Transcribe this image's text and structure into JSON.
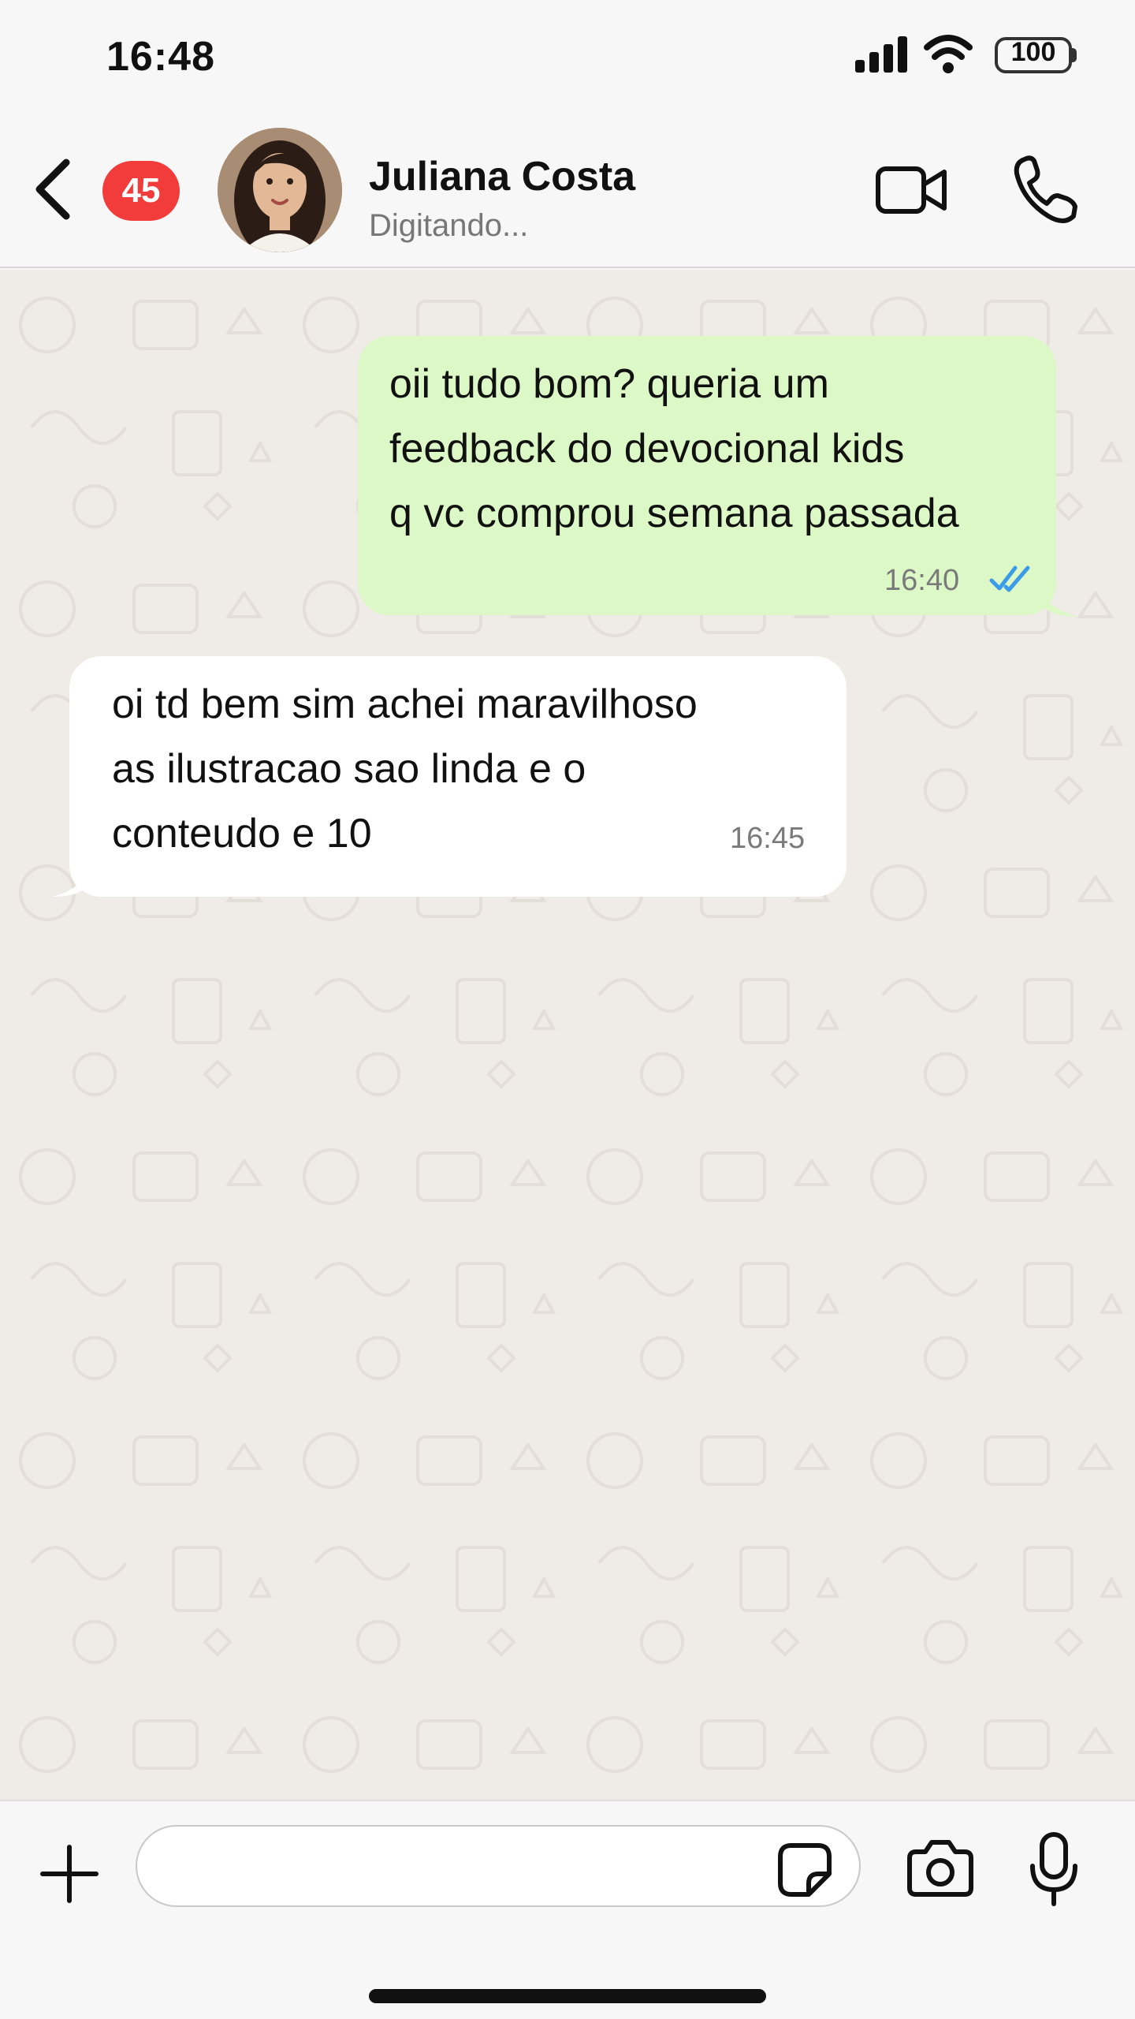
{
  "status_bar": {
    "time": "16:48",
    "battery_level": "100",
    "icons": [
      "signal-icon",
      "wifi-icon",
      "battery-icon"
    ]
  },
  "header": {
    "back_icon": "chevron-left-icon",
    "unread_count": "45",
    "contact_name": "Juliana Costa",
    "contact_status": "Digitando...",
    "video_icon": "video-camera-icon",
    "call_icon": "phone-icon"
  },
  "messages": [
    {
      "direction": "outgoing",
      "lines": [
        "oii tudo bom? queria um",
        "feedback do devocional kids",
        "q vc comprou semana passada"
      ],
      "time": "16:40",
      "status_icon": "double-check-icon"
    },
    {
      "direction": "incoming",
      "lines": [
        "oi td bem sim achei maravilhoso",
        "as ilustracao sao linda e o",
        "conteudo e 10"
      ],
      "time": "16:45"
    }
  ],
  "input_bar": {
    "plus_icon": "plus-icon",
    "input_value": "",
    "sticker_icon": "sticker-icon",
    "camera_icon": "camera-icon",
    "mic_icon": "microphone-icon"
  },
  "colors": {
    "outgoing_bubble": "#dcf8c6",
    "incoming_bubble": "#ffffff",
    "badge": "#f23b3b",
    "read_ticks": "#3b9be8",
    "chat_background": "#efebe6"
  }
}
